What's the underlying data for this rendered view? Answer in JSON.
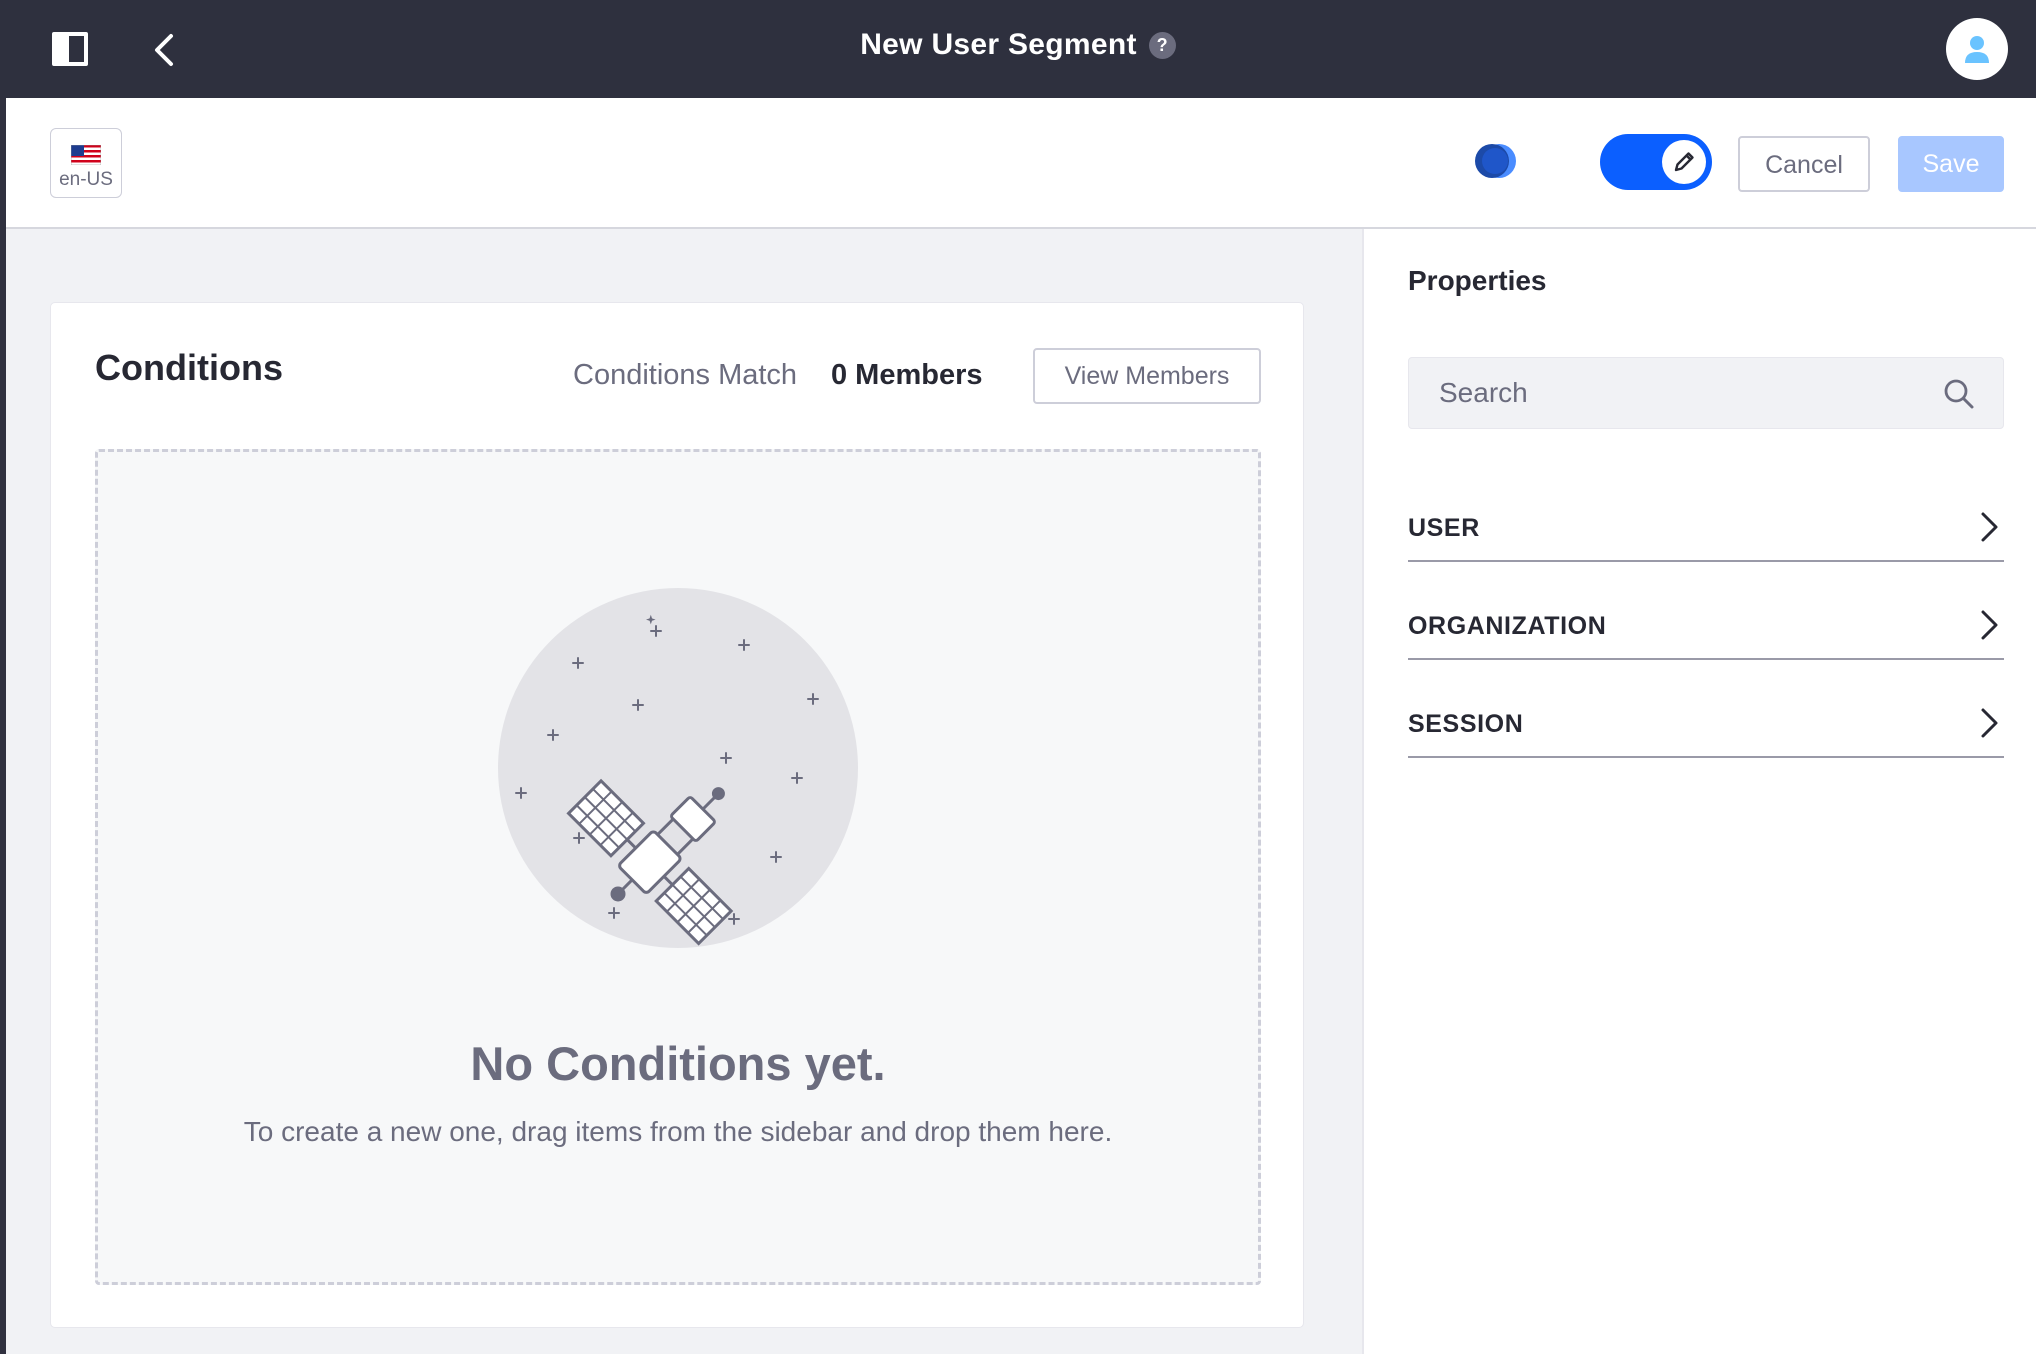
{
  "header": {
    "title": "New User Segment",
    "help_symbol": "?"
  },
  "toolbar": {
    "locale": "en-US",
    "cancel_label": "Cancel",
    "save_label": "Save",
    "edit_mode_enabled": true
  },
  "conditions": {
    "title": "Conditions",
    "match_label": "Conditions Match",
    "member_count": "0 Members",
    "view_members_label": "View Members",
    "empty_title": "No Conditions yet.",
    "empty_description": "To create a new one, drag items from the sidebar and drop them here."
  },
  "sidebar": {
    "title": "Properties",
    "search_placeholder": "Search",
    "panels": [
      {
        "label": "USER"
      },
      {
        "label": "ORGANIZATION"
      },
      {
        "label": "SESSION"
      }
    ]
  },
  "colors": {
    "topbar": "#2e303e",
    "primary": "#0b5fff",
    "save_disabled": "#a8c7ff",
    "secondary_text": "#6b6c7e"
  },
  "icons": [
    "sidebar-toggle-icon",
    "back-chevron-icon",
    "help-icon",
    "user-avatar-icon",
    "us-flag-icon",
    "experience-icon",
    "pencil-icon",
    "search-icon",
    "chevron-right-icon",
    "satellite-illustration"
  ]
}
